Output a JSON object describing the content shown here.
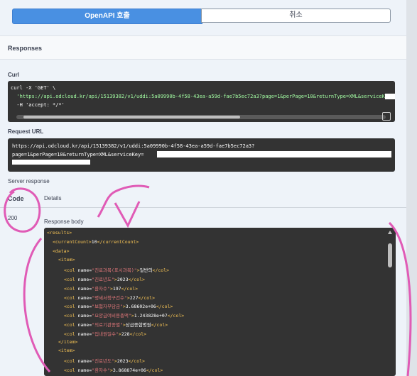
{
  "buttons": {
    "execute_label": "OpenAPI 호출",
    "cancel_label": "취소"
  },
  "responses_title": "Responses",
  "curl": {
    "label": "Curl",
    "line1": "curl -X 'GET' \\",
    "line2": "  'https://api.odcloud.kr/api/15139382/v1/uddi:5a09990b-4f58-43ea-a59d-fae7b5ec72a3?page=1&perPage=10&returnType=XML&serviceKey=",
    "line3": "  -H 'accept: */*'"
  },
  "request_url": {
    "label": "Request URL",
    "line1": "https://api.odcloud.kr/api/15139382/v1/uddi:5a09990b-4f58-43ea-a59d-fae7b5ec72a3?",
    "line2": "page=1&perPage=10&returnType=XML&serviceKey="
  },
  "server_response": {
    "label": "Server response",
    "code_header": "Code",
    "details_header": "Details",
    "code_value": "200",
    "body_label": "Response body"
  },
  "xml_lines": [
    {
      "indent": 0,
      "open": "<results>"
    },
    {
      "indent": 1,
      "open": "<currentCount>",
      "text": "10",
      "close": "</currentCount>"
    },
    {
      "indent": 1,
      "open": "<data>"
    },
    {
      "indent": 2,
      "open": "<item>"
    },
    {
      "indent": 3,
      "name": "진료과목(표시과목)",
      "text": "일반의"
    },
    {
      "indent": 3,
      "name": "진료년도",
      "text": "2023"
    },
    {
      "indent": 3,
      "name": "환자수",
      "text": "197"
    },
    {
      "indent": 3,
      "name": "명세서청구건수",
      "text": "227"
    },
    {
      "indent": 3,
      "name": "보험자부담금",
      "text": "3.68602e+06"
    },
    {
      "indent": 3,
      "name": "요양급여비용총액",
      "text": "1.243828e+07"
    },
    {
      "indent": 3,
      "name": "의료기관종별",
      "text": "상급종합병원"
    },
    {
      "indent": 3,
      "name": "입내원일수",
      "text": "228"
    },
    {
      "indent": 2,
      "open": "</item>"
    },
    {
      "indent": 2,
      "open": "<item>"
    },
    {
      "indent": 3,
      "name": "진료년도",
      "text": "2023"
    },
    {
      "indent": 3,
      "name": "환자수",
      "text": "3.868874e+06"
    }
  ],
  "colors": {
    "accent": "#4990e2",
    "annotation": "#e05bb6",
    "code_bg": "#333333"
  }
}
